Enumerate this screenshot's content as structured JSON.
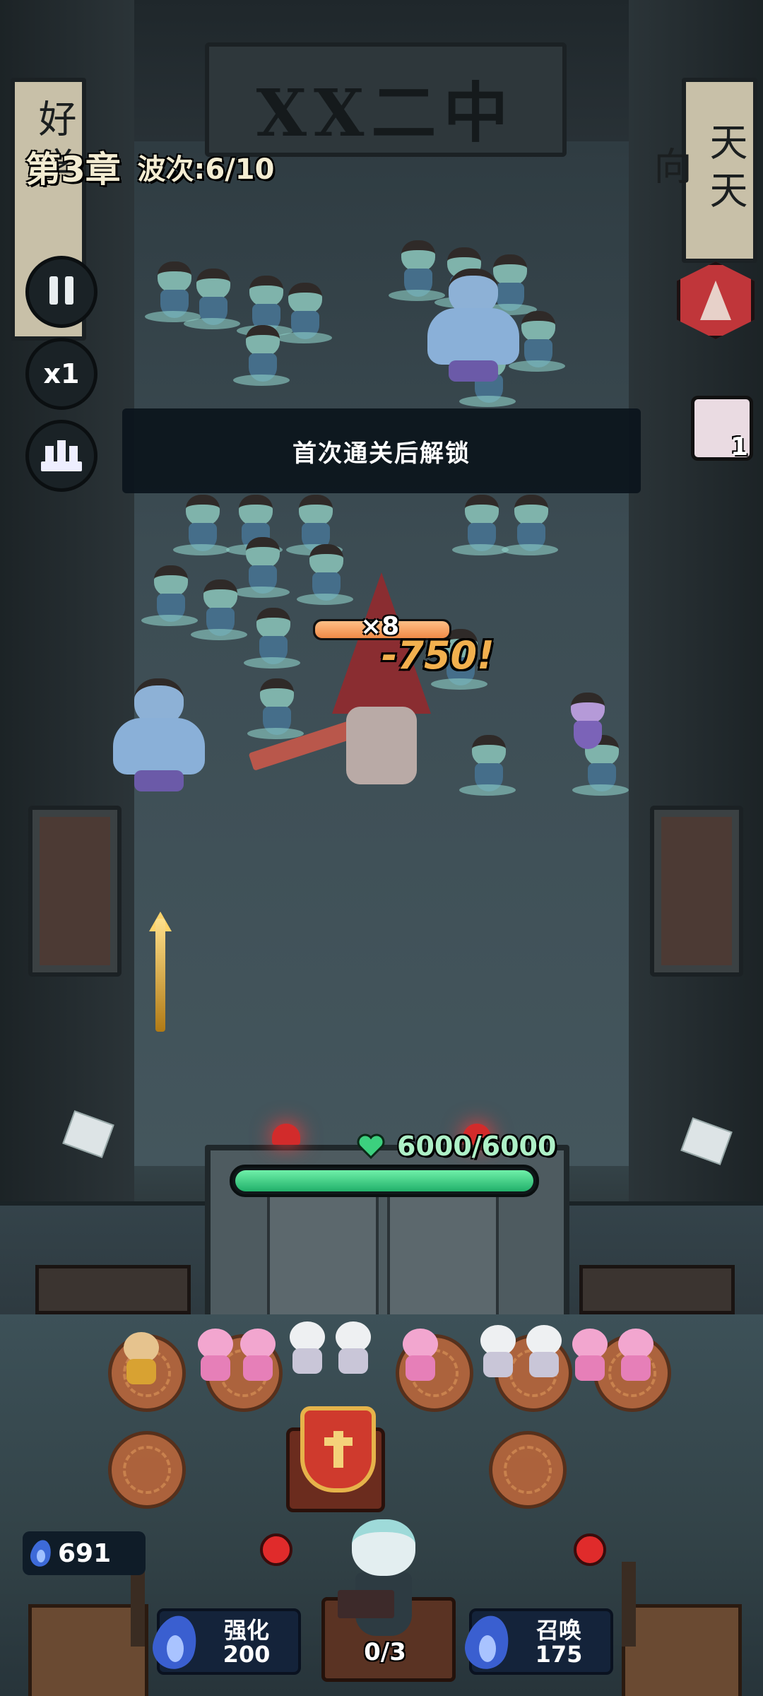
{
  "hud": {
    "chapter_label": "第3章",
    "wave_label": "波次:6/10",
    "speed_label": "x1"
  },
  "gate_sign": {
    "text": "XX二中"
  },
  "banners": {
    "left": "好学",
    "right": "天天向"
  },
  "toast": {
    "message": "首次通关后解锁"
  },
  "unit_card": {
    "count": "1"
  },
  "boss": {
    "hp_multiplier": "×8",
    "hp_fraction": 1.0,
    "damage_popup": "-750!"
  },
  "base": {
    "hp_text": "6000/6000",
    "hp_fraction": 1.0
  },
  "resources": {
    "soul_count": "691"
  },
  "actions": {
    "upgrade": {
      "label": "强化",
      "cost": "200"
    },
    "summon": {
      "label": "召唤",
      "cost": "175"
    }
  },
  "capacity": {
    "text": "0/3"
  },
  "colors": {
    "gate_hp": "#21b06a",
    "boss_badge": "#c0363a",
    "damage": "#f2b04e",
    "soul_flame": "#3d6ad8"
  },
  "icons": {
    "pause": "pause-icon",
    "rank": "leaderboard-icon",
    "boss": "pyramid-head-icon",
    "heart": "heart-icon",
    "soul": "blue-flame-icon"
  }
}
